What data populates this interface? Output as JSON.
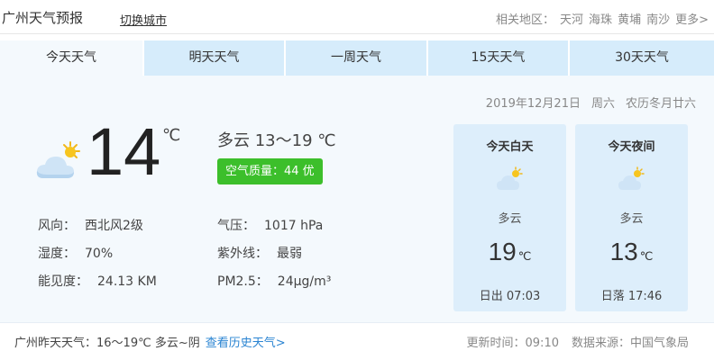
{
  "header": {
    "title": "广州天气预报",
    "switch_city": "切换城市",
    "related_label": "相关地区：",
    "related_areas": [
      "天河",
      "海珠",
      "黄埔",
      "南沙"
    ],
    "more": "更多>"
  },
  "tabs": [
    {
      "label": "今天天气",
      "active": true
    },
    {
      "label": "明天天气",
      "active": false
    },
    {
      "label": "一周天气",
      "active": false
    },
    {
      "label": "15天天气",
      "active": false
    },
    {
      "label": "30天天气",
      "active": false
    }
  ],
  "date": {
    "date": "2019年12月21日",
    "weekday": "周六",
    "lunar": "农历冬月廿六"
  },
  "current": {
    "icon": "partly-cloudy-icon",
    "temp": "14",
    "unit": "℃",
    "condition_range": "多云 13～19 ℃",
    "aqi": "空气质量：44  优",
    "aqi_color": "#3cbf2b"
  },
  "details": {
    "wind_label": "风向：",
    "wind_value": "西北风2级",
    "humidity_label": "湿度：",
    "humidity_value": "70%",
    "visibility_label": "能见度：",
    "visibility_value": "24.13 KM",
    "pressure_label": "气压：",
    "pressure_value": "1017 hPa",
    "uv_label": "紫外线：",
    "uv_value": "最弱",
    "pm25_label": "PM2.5：",
    "pm25_value": "24μg/m³"
  },
  "day_card": {
    "title": "今天白天",
    "icon": "partly-cloudy-icon",
    "condition": "多云",
    "temp": "19",
    "unit": "℃",
    "sun": "日出 07:03"
  },
  "night_card": {
    "title": "今天夜间",
    "icon": "partly-cloudy-icon",
    "condition": "多云",
    "temp": "13",
    "unit": "℃",
    "sun": "日落 17:46"
  },
  "footer": {
    "yesterday": "广州昨天天气：16～19℃ 多云~阴",
    "history_link": "查看历史天气>",
    "update": "更新时间：09:10",
    "source": "数据来源：中国气象局"
  },
  "colors": {
    "tab_bg": "#d6ecfb",
    "panel_bg": "#f4f9fd",
    "card_bg": "#ddeefb",
    "link": "#2a84d2"
  }
}
